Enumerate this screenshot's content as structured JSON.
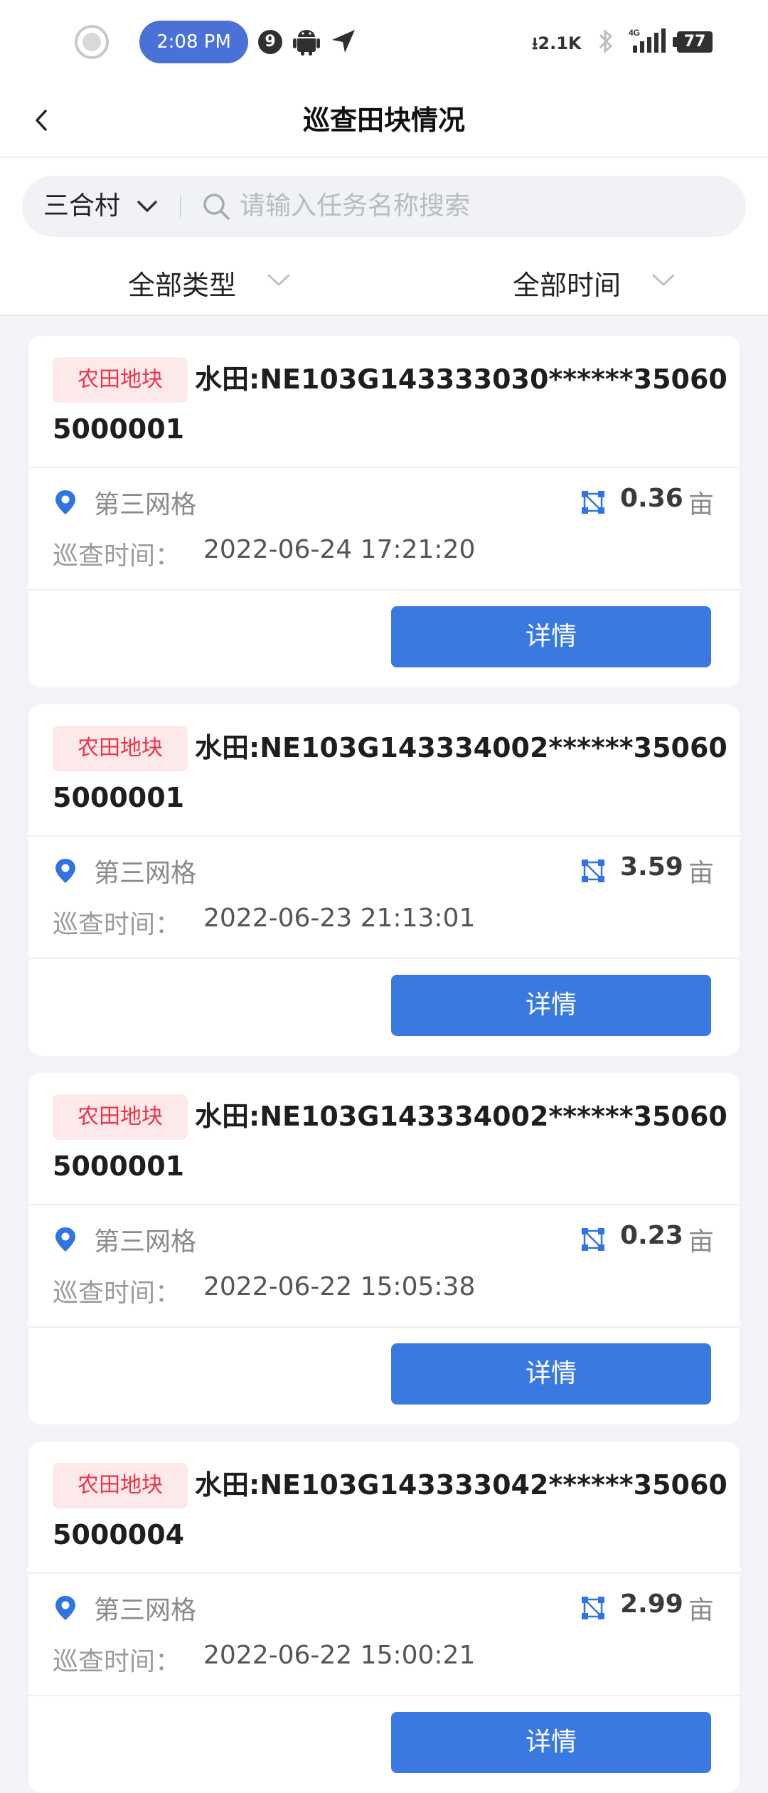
{
  "status_bar": {
    "time": "2:08 PM",
    "notification_count": "9",
    "network_speed": "2.1K",
    "network_type": "4G",
    "battery": "77"
  },
  "header": {
    "title": "巡查田块情况"
  },
  "filters": {
    "village": "三合村",
    "search_placeholder": "请输入任务名称搜索",
    "type_label": "全部类型",
    "time_label": "全部时间"
  },
  "labels": {
    "inspection_time": "巡查时间：",
    "detail_button": "详情",
    "area_unit": "亩"
  },
  "colors": {
    "primary": "#3a7ae0",
    "tag_text": "#e8364a",
    "tag_bg": "#fde8ea"
  },
  "records": [
    {
      "tag": "农田地块",
      "title": "水田:NE103G143333030******350605000001",
      "grid": "第三网格",
      "area": "0.36",
      "time": "2022-06-24 17:21:20"
    },
    {
      "tag": "农田地块",
      "title": "水田:NE103G143334002******350605000001",
      "grid": "第三网格",
      "area": "3.59",
      "time": "2022-06-23 21:13:01"
    },
    {
      "tag": "农田地块",
      "title": "水田:NE103G143334002******350605000001",
      "grid": "第三网格",
      "area": "0.23",
      "time": "2022-06-22 15:05:38"
    },
    {
      "tag": "农田地块",
      "title": "水田:NE103G143333042******350605000004",
      "grid": "第三网格",
      "area": "2.99",
      "time": "2022-06-22 15:00:21"
    }
  ]
}
